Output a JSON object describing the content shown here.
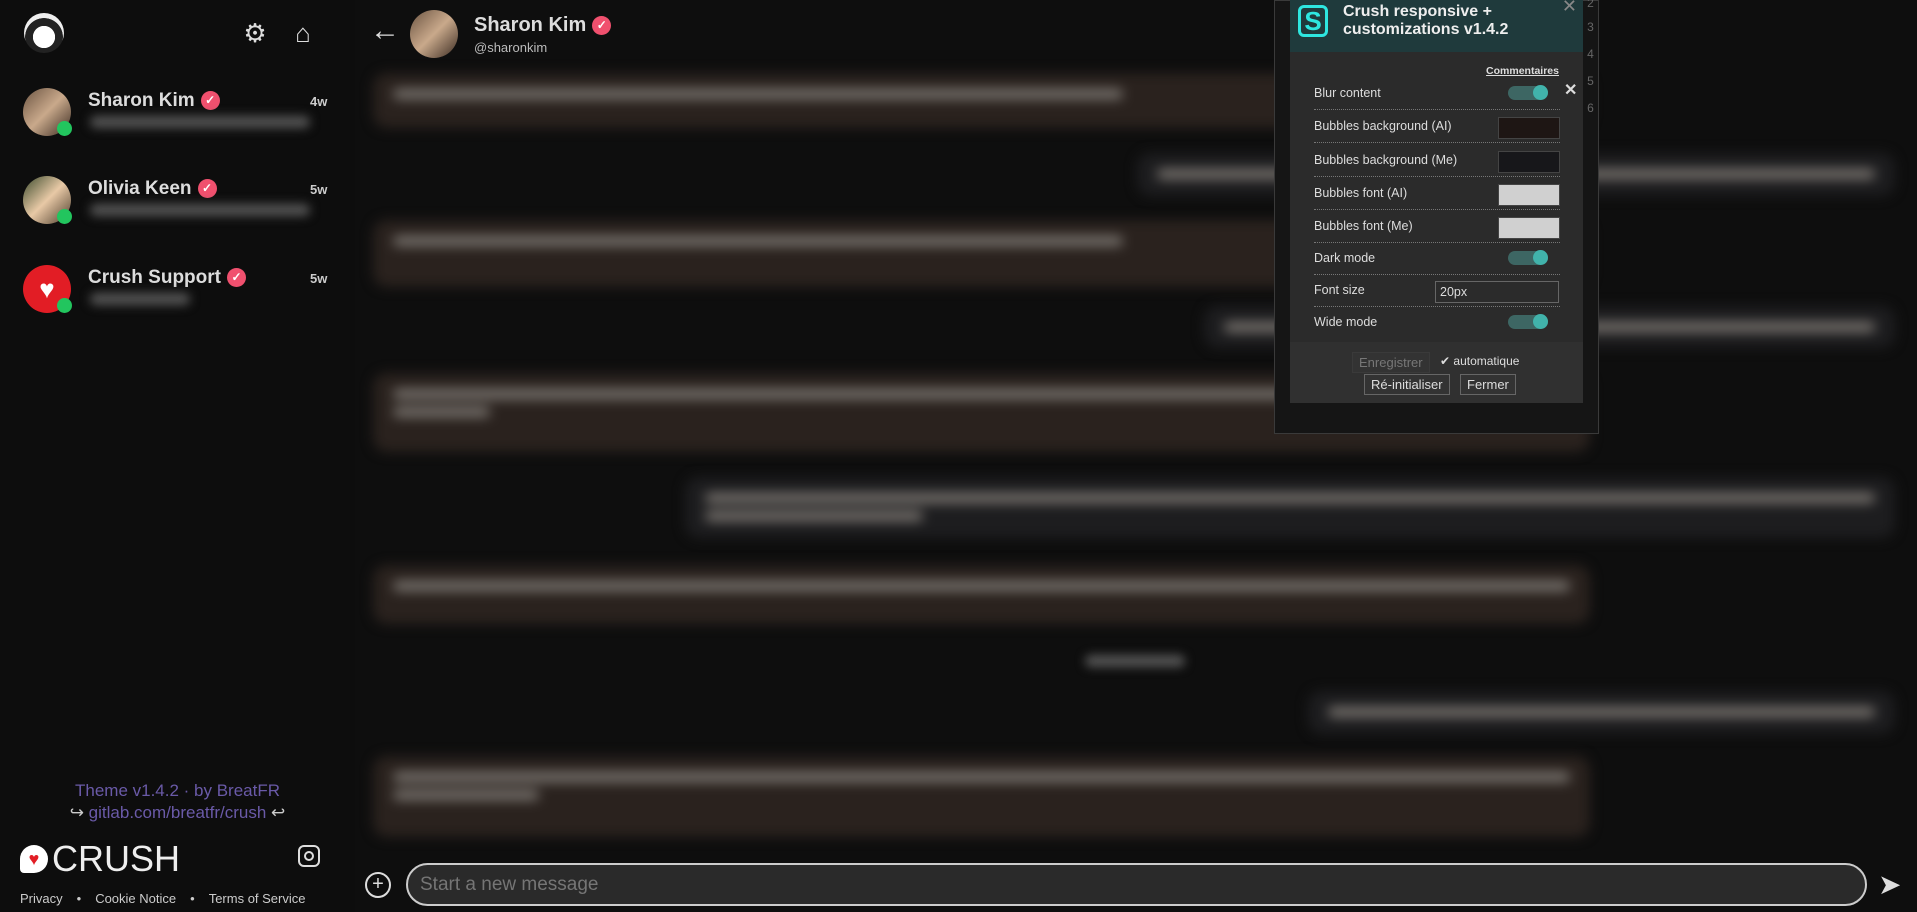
{
  "sidebar": {
    "conversations": [
      {
        "name": "Sharon Kim",
        "time": "4w",
        "verified": true,
        "online": true
      },
      {
        "name": "Olivia Keen",
        "time": "5w",
        "verified": true,
        "online": true
      },
      {
        "name": "Crush Support",
        "time": "5w",
        "verified": true,
        "online": true
      }
    ],
    "theme_line": "Theme v1.4.2 · by BreatFR",
    "theme_link": "gitlab.com/breatfr/crush",
    "logo": "CRUSH",
    "footer_links": [
      "Privacy",
      "Cookie Notice",
      "Terms of Service"
    ]
  },
  "header": {
    "name": "Sharon Kim",
    "handle": "@sharonkim",
    "verified": true
  },
  "composer": {
    "placeholder": "Start a new message"
  },
  "background_table": {
    "numbers": [
      "2",
      "3",
      "4",
      "5",
      "6"
    ]
  },
  "panel": {
    "title": "Crush responsive + customizations v1.4.2",
    "comments_link": "Commentaires",
    "settings": [
      {
        "label": "Blur content",
        "type": "toggle",
        "on": true
      },
      {
        "label": "Bubbles background (AI)",
        "type": "color",
        "value": "#1e1614"
      },
      {
        "label": "Bubbles background (Me)",
        "type": "color",
        "value": "#17171a"
      },
      {
        "label": "Bubbles font (AI)",
        "type": "color",
        "value": "#d0d0d0"
      },
      {
        "label": "Bubbles font (Me)",
        "type": "color",
        "value": "#d0d0d0"
      },
      {
        "label": "Dark mode",
        "type": "toggle",
        "on": true
      },
      {
        "label": "Font size",
        "type": "text",
        "value": "20px"
      },
      {
        "label": "Wide mode",
        "type": "toggle",
        "on": true
      }
    ],
    "save_label": "Enregistrer",
    "auto_label": "automatique",
    "reset_label": "Ré-initialiser",
    "close_label": "Fermer"
  },
  "colors": {
    "accent": "#f0506e",
    "online": "#22c55e",
    "panel_accent": "#41b3ab"
  }
}
